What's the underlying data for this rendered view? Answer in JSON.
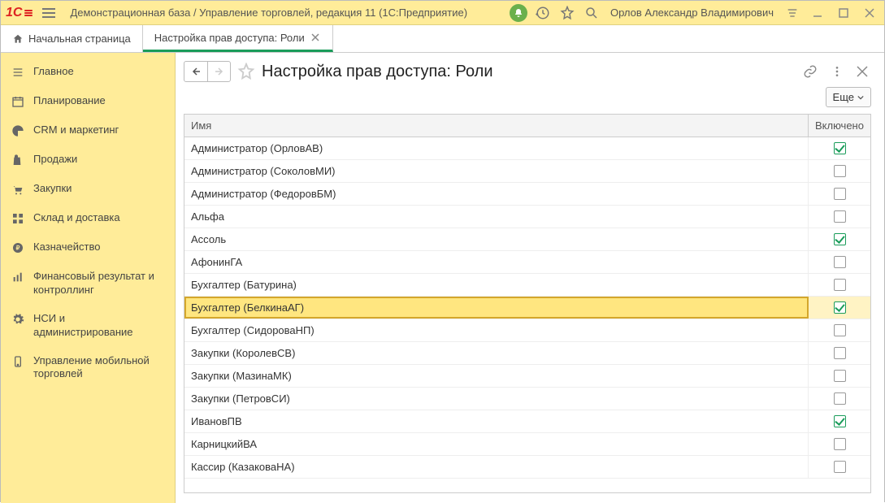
{
  "topbar": {
    "app_title": "Демонстрационная база / Управление торговлей, редакция 11  (1С:Предприятие)",
    "user_name": "Орлов Александр Владимирович"
  },
  "tabs": {
    "home": "Начальная страница",
    "active": "Настройка прав доступа: Роли"
  },
  "sidebar": {
    "items": [
      {
        "label": "Главное"
      },
      {
        "label": "Планирование"
      },
      {
        "label": "CRM и маркетинг"
      },
      {
        "label": "Продажи"
      },
      {
        "label": "Закупки"
      },
      {
        "label": "Склад и доставка"
      },
      {
        "label": "Казначейство"
      },
      {
        "label": "Финансовый результат и контроллинг"
      },
      {
        "label": "НСИ и администрирование"
      },
      {
        "label": "Управление мобильной торговлей"
      }
    ]
  },
  "content": {
    "title": "Настройка прав доступа: Роли",
    "more_label": "Еще",
    "columns": {
      "name": "Имя",
      "enabled": "Включено"
    },
    "rows": [
      {
        "name": "Администратор (ОрловАВ)",
        "enabled": true
      },
      {
        "name": "Администратор (СоколовМИ)",
        "enabled": false
      },
      {
        "name": "Администратор (ФедоровБМ)",
        "enabled": false
      },
      {
        "name": "Альфа",
        "enabled": false
      },
      {
        "name": "Ассоль",
        "enabled": true
      },
      {
        "name": "АфонинГА",
        "enabled": false
      },
      {
        "name": "Бухгалтер (Батурина)",
        "enabled": false
      },
      {
        "name": "Бухгалтер (БелкинаАГ)",
        "enabled": true,
        "selected": true
      },
      {
        "name": "Бухгалтер (СидороваНП)",
        "enabled": false
      },
      {
        "name": "Закупки (КоролевСВ)",
        "enabled": false
      },
      {
        "name": "Закупки (МазинаМК)",
        "enabled": false
      },
      {
        "name": "Закупки (ПетровСИ)",
        "enabled": false
      },
      {
        "name": "ИвановПВ",
        "enabled": true
      },
      {
        "name": "КарницкийВА",
        "enabled": false
      },
      {
        "name": "Кассир (КазаковаНА)",
        "enabled": false
      }
    ]
  }
}
